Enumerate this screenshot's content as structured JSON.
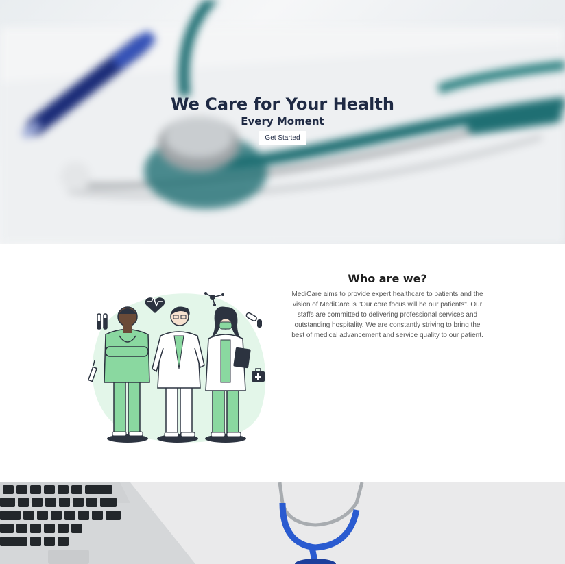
{
  "hero": {
    "title": "We Care for Your Health",
    "subtitle": "Every Moment",
    "cta_label": "Get Started"
  },
  "about": {
    "heading": "Who are we?",
    "paragraph": "MediCare aims to provide expert healthcare to patients and the vision of MediCare is \"Our core focus will be our patients\". Our staffs are committed to delivering professional services and outstanding hospitality. We are constantly striving to bring the best of medical advancement and service quality to our patient."
  },
  "colors": {
    "hero_text": "#1f2a44",
    "accent_green": "#8ad8a0",
    "stethoscope_teal": "#1f6f73",
    "stethoscope_blue": "#2a5bd0"
  },
  "icons": [
    "heart-pulse-icon",
    "molecule-icon",
    "test-tubes-icon",
    "pill-icon",
    "syringe-icon",
    "first-aid-kit-icon"
  ]
}
